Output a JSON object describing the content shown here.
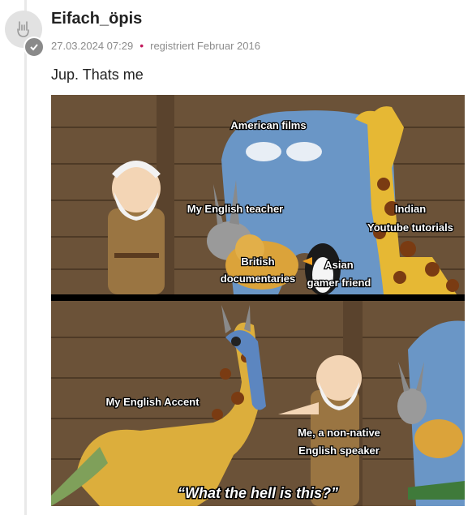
{
  "post": {
    "username": "Eifach_öpis",
    "timestamp": "27.03.2024 07:29",
    "registered": "registriert Februar 2016",
    "text": "Jup. Thats me",
    "avatar_icon": "rock-hand-icon",
    "badge_icon": "check-icon",
    "accent_color": "#c2185b"
  },
  "meme": {
    "top_captions": {
      "american_films": "American films",
      "english_teacher": "My English teacher",
      "indian": "Indian",
      "youtube_tutorials": "Youtube tutorials",
      "british": "British",
      "documentaries": "documentaries",
      "asian": "Asian",
      "gamer_friend": "gamer friend"
    },
    "bottom_captions": {
      "english_accent": "My English Accent",
      "non_native_1": "Me, a non-native",
      "non_native_2": "English speaker",
      "what_the_hell": "“What the hell is this?”"
    }
  }
}
